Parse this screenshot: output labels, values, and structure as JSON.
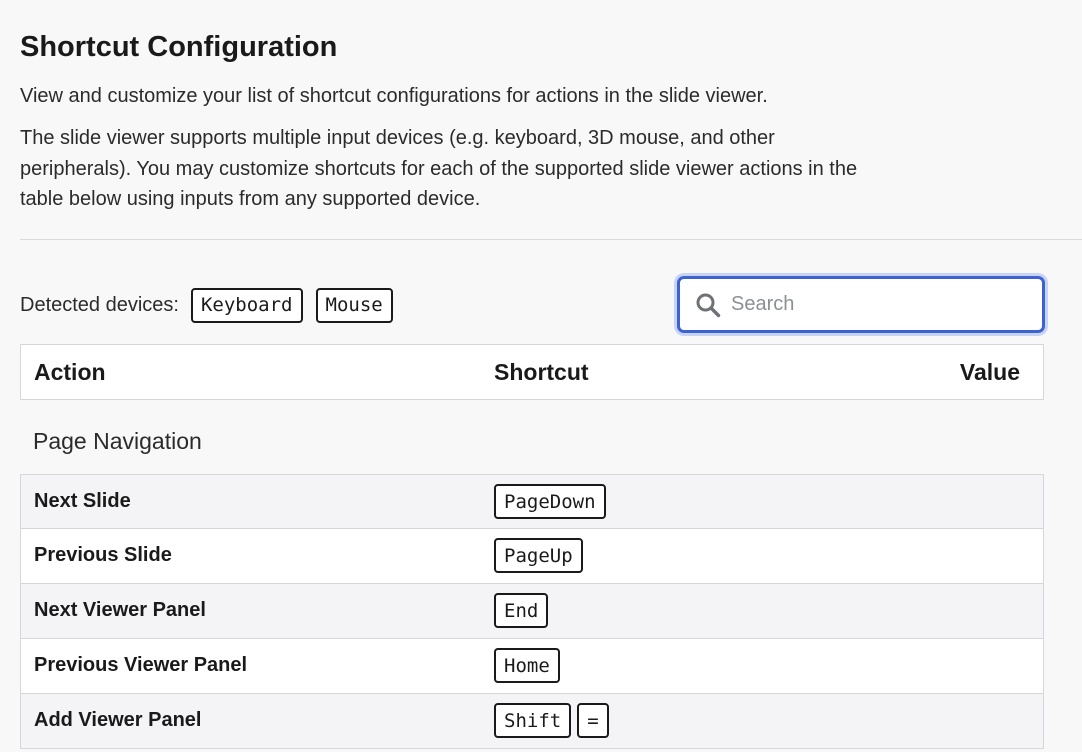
{
  "header": {
    "title": "Shortcut Configuration",
    "description_1": "View and customize your list of shortcut configurations for actions in the slide viewer.",
    "description_2": "The slide viewer supports multiple input devices (e.g. keyboard, 3D mouse, and other peripherals). You may customize shortcuts for each of the supported slide viewer actions in the table below using inputs from any supported device."
  },
  "devices": {
    "label": "Detected devices:",
    "items": [
      "Keyboard",
      "Mouse"
    ]
  },
  "search": {
    "placeholder": "Search",
    "value": "",
    "icon": "search-icon"
  },
  "table": {
    "columns": {
      "action": "Action",
      "shortcut": "Shortcut",
      "value": "Value"
    },
    "groups": [
      {
        "title": "Page Navigation",
        "rows": [
          {
            "action": "Next Slide",
            "keys": [
              "PageDown"
            ]
          },
          {
            "action": "Previous Slide",
            "keys": [
              "PageUp"
            ]
          },
          {
            "action": "Next Viewer Panel",
            "keys": [
              "End"
            ]
          },
          {
            "action": "Previous Viewer Panel",
            "keys": [
              "Home"
            ]
          },
          {
            "action": "Add Viewer Panel",
            "keys": [
              "Shift",
              "="
            ]
          }
        ]
      }
    ]
  },
  "colors": {
    "focus_border": "#3d63d3",
    "focus_ring": "#c8d4f5",
    "row_alt": "#f4f4f6",
    "border": "#d6d7da"
  }
}
